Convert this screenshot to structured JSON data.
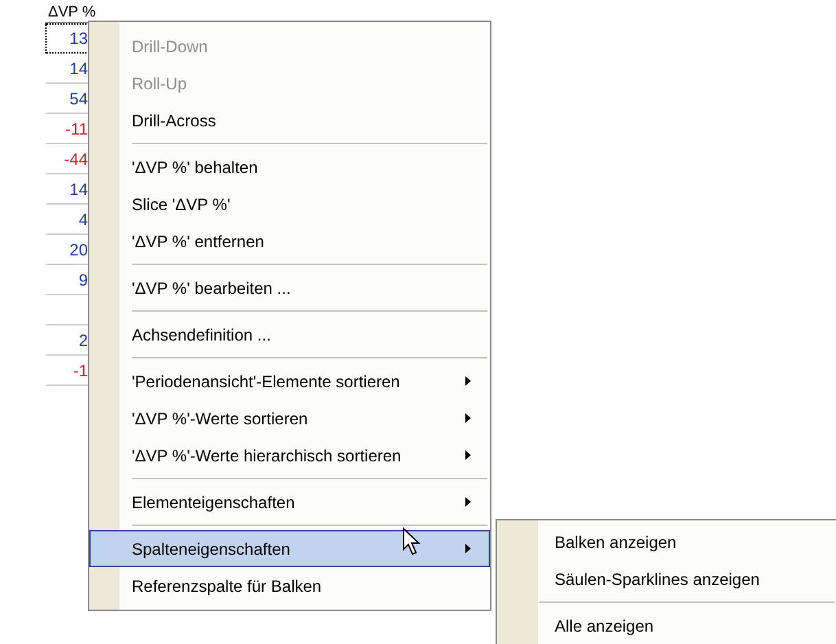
{
  "table": {
    "column_header": "ΔVP %",
    "cells": [
      {
        "value": "13",
        "color": "#1f3f99",
        "focused": true
      },
      {
        "value": "14",
        "color": "#1f3f99",
        "focused": false
      },
      {
        "value": "54",
        "color": "#1f3f99",
        "focused": false
      },
      {
        "value": "-11",
        "color": "#d0202a",
        "focused": false
      },
      {
        "value": "-44",
        "color": "#d0202a",
        "focused": false
      },
      {
        "value": "14",
        "color": "#1f3f99",
        "focused": false
      },
      {
        "value": "4",
        "color": "#1f3f99",
        "focused": false
      },
      {
        "value": "20",
        "color": "#1f3f99",
        "focused": false
      },
      {
        "value": "9",
        "color": "#1f3f99",
        "focused": false
      },
      {
        "focused": false
      },
      {
        "value": "2",
        "color": "#1f3f99",
        "focused": false
      },
      {
        "value": "-1",
        "color": "#d0202a",
        "focused": false
      }
    ]
  },
  "context_menu": {
    "items": [
      {
        "kind": "item",
        "label": "Drill-Down",
        "disabled": true,
        "submenu": false,
        "selected": false
      },
      {
        "kind": "item",
        "label": "Roll-Up",
        "disabled": true,
        "submenu": false,
        "selected": false
      },
      {
        "kind": "item",
        "label": "Drill-Across",
        "disabled": false,
        "submenu": false,
        "selected": false
      },
      {
        "kind": "separator"
      },
      {
        "kind": "item",
        "label": "'ΔVP %' behalten",
        "disabled": false,
        "submenu": false,
        "selected": false
      },
      {
        "kind": "item",
        "label": "Slice 'ΔVP %'",
        "disabled": false,
        "submenu": false,
        "selected": false
      },
      {
        "kind": "item",
        "label": "'ΔVP %' entfernen",
        "disabled": false,
        "submenu": false,
        "selected": false
      },
      {
        "kind": "separator"
      },
      {
        "kind": "item",
        "label": "'ΔVP %' bearbeiten ...",
        "disabled": false,
        "submenu": false,
        "selected": false
      },
      {
        "kind": "separator"
      },
      {
        "kind": "item",
        "label": "Achsendefinition ...",
        "disabled": false,
        "submenu": false,
        "selected": false
      },
      {
        "kind": "separator"
      },
      {
        "kind": "item",
        "label": "'Periodenansicht'-Elemente sortieren",
        "disabled": false,
        "submenu": true,
        "selected": false
      },
      {
        "kind": "item",
        "label": "'ΔVP %'-Werte sortieren",
        "disabled": false,
        "submenu": true,
        "selected": false
      },
      {
        "kind": "item",
        "label": "'ΔVP %'-Werte hierarchisch sortieren",
        "disabled": false,
        "submenu": true,
        "selected": false
      },
      {
        "kind": "separator"
      },
      {
        "kind": "item",
        "label": "Elementeigenschaften",
        "disabled": false,
        "submenu": true,
        "selected": false
      },
      {
        "kind": "separator"
      },
      {
        "kind": "item",
        "label": "Spalteneigenschaften",
        "disabled": false,
        "submenu": true,
        "selected": true
      },
      {
        "kind": "item",
        "label": "Referenzspalte für Balken",
        "disabled": false,
        "submenu": false,
        "selected": false
      }
    ]
  },
  "submenu": {
    "items": [
      {
        "kind": "item",
        "label": "Balken anzeigen"
      },
      {
        "kind": "item",
        "label": "Säulen-Sparklines anzeigen"
      },
      {
        "kind": "separator"
      },
      {
        "kind": "item",
        "label": "Alle anzeigen"
      }
    ]
  }
}
